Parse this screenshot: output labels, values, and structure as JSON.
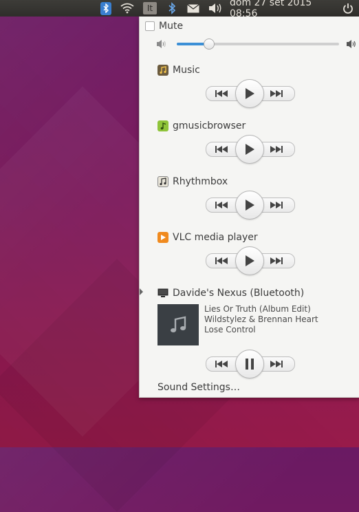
{
  "panel": {
    "keyboard_layout": "It",
    "clock": "dom 27 set 2015 08:56",
    "icons": [
      "bluetooth-icon",
      "wifi-icon",
      "keyboard-layout-indicator",
      "bluetooth-icon",
      "mail-icon",
      "volume-icon",
      "power-icon"
    ]
  },
  "sound_menu": {
    "mute_label": "Mute",
    "volume": 0.2,
    "players": [
      {
        "name": "Music",
        "icon": "music-app-icon",
        "icon_color": "#6b5b3e",
        "state": "paused"
      },
      {
        "name": "gmusicbrowser",
        "icon": "gmusicbrowser-icon",
        "icon_color": "#8fc43a",
        "state": "paused"
      },
      {
        "name": "Rhythmbox",
        "icon": "rhythmbox-icon",
        "icon_color": "#e8e4d8",
        "state": "paused"
      },
      {
        "name": "VLC media player",
        "icon": "vlc-icon",
        "icon_color": "#f08a1e",
        "state": "paused"
      }
    ],
    "active_player": {
      "name": "Davide's Nexus (Bluetooth)",
      "icon": "phone-device-icon",
      "track_title": "Lies Or Truth (Album Edit)",
      "track_artist": "Wildstylez & Brennan Heart",
      "track_album": "Lose Control",
      "state": "playing"
    },
    "settings_label": "Sound Settings…"
  },
  "colors": {
    "accent": "#3b8fd6",
    "bluetooth_badge": "#3a7fd0"
  }
}
